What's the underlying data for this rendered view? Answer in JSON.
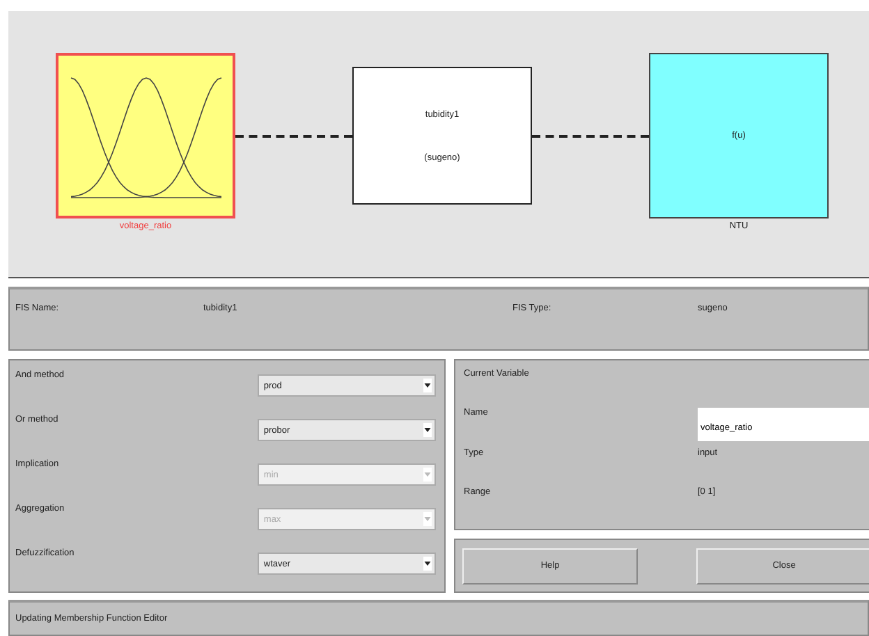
{
  "diagram": {
    "inputs": [
      {
        "label": "voltage_ratio",
        "selected": true
      }
    ],
    "system": {
      "name": "tubidity1",
      "type": "(sugeno)"
    },
    "outputs": [
      {
        "label": "NTU",
        "formula": "f(u)",
        "selected": false
      }
    ]
  },
  "fis": {
    "name_label": "FIS Name:",
    "name": "tubidity1",
    "type_label": "FIS Type:",
    "type": "sugeno"
  },
  "methods": [
    {
      "label": "And method",
      "value": "prod",
      "disabled": false
    },
    {
      "label": "Or method",
      "value": "probor",
      "disabled": false
    },
    {
      "label": "Implication",
      "value": "min",
      "disabled": true
    },
    {
      "label": "Aggregation",
      "value": "max",
      "disabled": true
    },
    {
      "label": "Defuzzification",
      "value": "wtaver",
      "disabled": false
    }
  ],
  "current_variable": {
    "title": "Current Variable",
    "name_label": "Name",
    "name": "voltage_ratio",
    "type_label": "Type",
    "type": "input",
    "range_label": "Range",
    "range": "[0 1]"
  },
  "buttons": [
    "Help",
    "Close"
  ],
  "status": "Updating Membership Function Editor"
}
